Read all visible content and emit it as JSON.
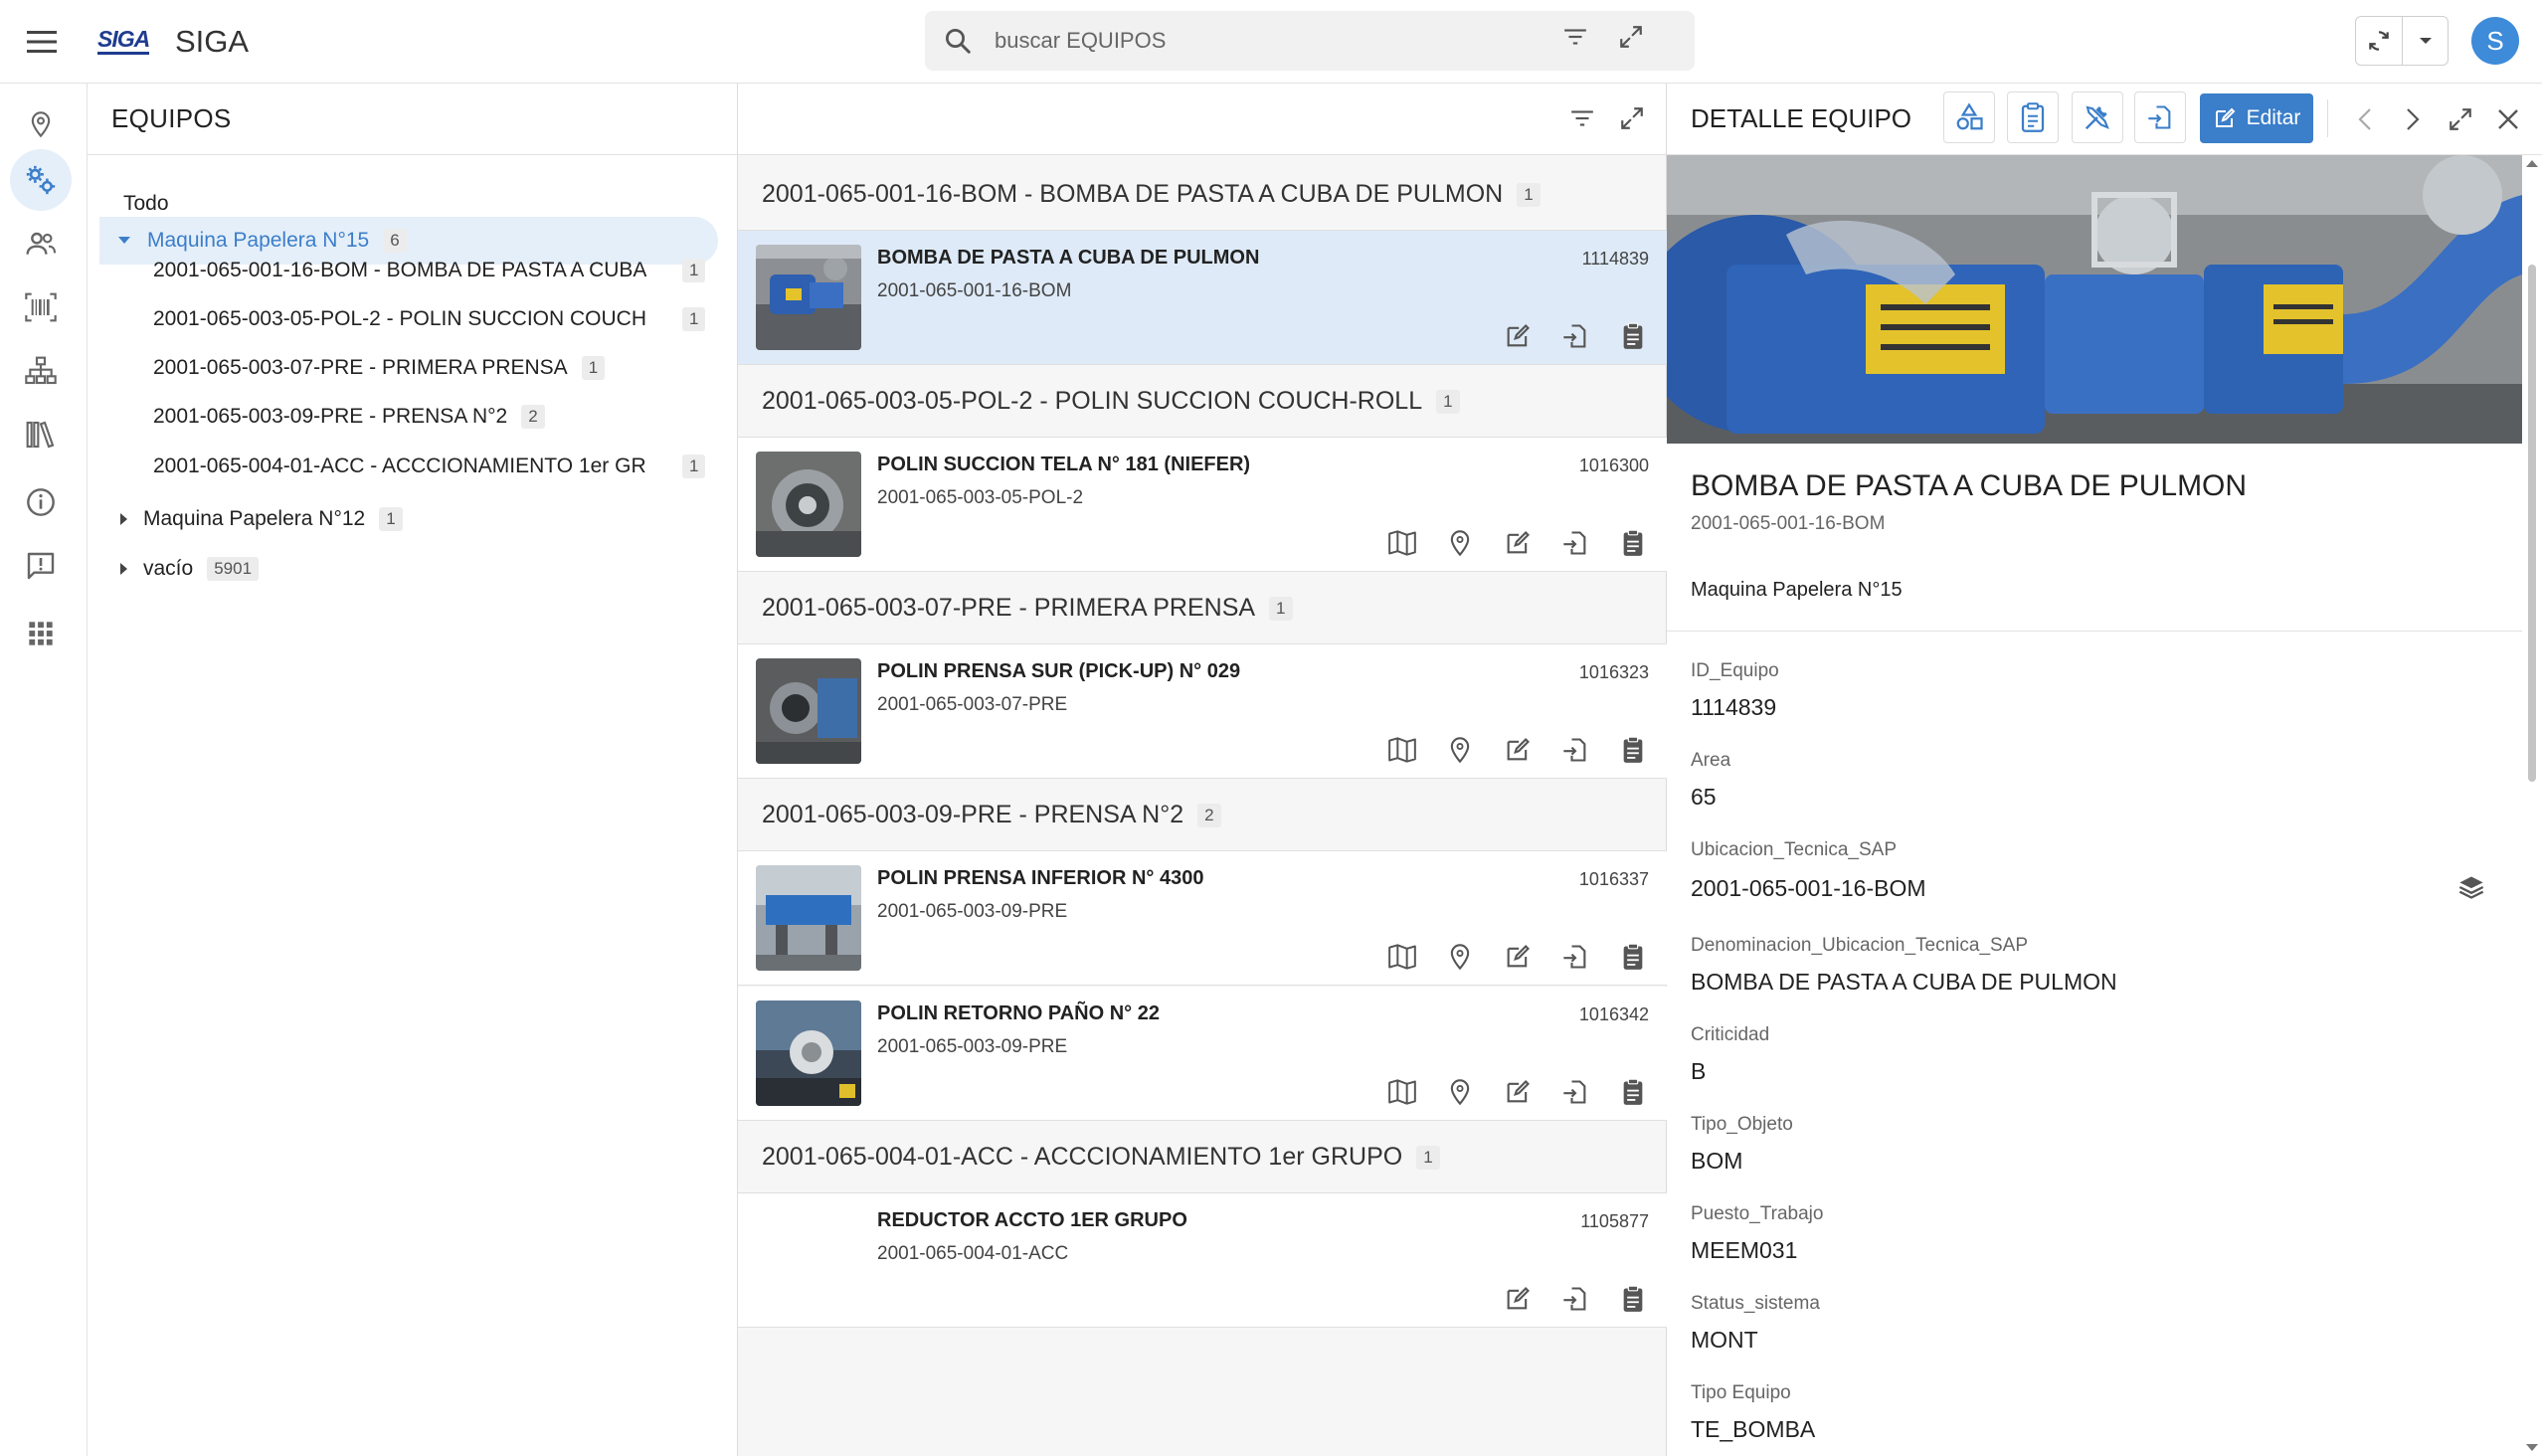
{
  "app": {
    "logo": "SIGA",
    "title": "SIGA",
    "avatar_initial": "S"
  },
  "search": {
    "placeholder": "buscar EQUIPOS",
    "value": ""
  },
  "tree": {
    "header": "EQUIPOS",
    "root": "Todo",
    "nodes": [
      {
        "label": "Maquina Papelera N°15",
        "count": "6",
        "expanded": true
      },
      {
        "label": "2001-065-001-16-BOM - BOMBA DE PASTA A CUBA ...",
        "count": "1"
      },
      {
        "label": "2001-065-003-05-POL-2 - POLIN SUCCION COUCH-...",
        "count": "1"
      },
      {
        "label": "2001-065-003-07-PRE - PRIMERA PRENSA",
        "count": "1"
      },
      {
        "label": "2001-065-003-09-PRE - PRENSA N°2",
        "count": "2"
      },
      {
        "label": "2001-065-004-01-ACC - ACCCIONAMIENTO 1er GR...",
        "count": "1"
      },
      {
        "label": "Maquina Papelera N°12",
        "count": "1"
      },
      {
        "label": "vacío",
        "count": "5901"
      }
    ]
  },
  "list": {
    "groups": [
      {
        "title": "2001-065-001-16-BOM - BOMBA DE PASTA A CUBA DE PULMON",
        "count": "1"
      },
      {
        "title": "2001-065-003-05-POL-2 - POLIN SUCCION COUCH-ROLL",
        "count": "1"
      },
      {
        "title": "2001-065-003-07-PRE - PRIMERA PRENSA",
        "count": "1"
      },
      {
        "title": "2001-065-003-09-PRE - PRENSA N°2",
        "count": "2"
      },
      {
        "title": "2001-065-004-01-ACC - ACCCIONAMIENTO 1er GRUPO",
        "count": "1"
      }
    ],
    "cards": [
      {
        "title": "BOMBA DE PASTA A CUBA DE PULMON",
        "code": "2001-065-001-16-BOM",
        "id": "1114839"
      },
      {
        "title": "POLIN SUCCION TELA N° 181 (NIEFER)",
        "code": "2001-065-003-05-POL-2",
        "id": "1016300"
      },
      {
        "title": "POLIN PRENSA SUR (PICK-UP) N° 029",
        "code": "2001-065-003-07-PRE",
        "id": "1016323"
      },
      {
        "title": "POLIN PRENSA INFERIOR N° 4300",
        "code": "2001-065-003-09-PRE",
        "id": "1016337"
      },
      {
        "title": "POLIN RETORNO PAÑO N° 22",
        "code": "2001-065-003-09-PRE",
        "id": "1016342"
      },
      {
        "title": "REDUCTOR ACCTO 1ER GRUPO",
        "code": "2001-065-004-01-ACC",
        "id": "1105877"
      }
    ]
  },
  "detail": {
    "header": "DETALLE EQUIPO",
    "edit_label": "Editar",
    "name": "BOMBA DE PASTA A CUBA DE PULMON",
    "code": "2001-065-001-16-BOM",
    "location": "Maquina Papelera N°15",
    "fields": [
      {
        "label": "ID_Equipo",
        "value": "1114839"
      },
      {
        "label": "Area",
        "value": "65"
      },
      {
        "label": "Ubicacion_Tecnica_SAP",
        "value": "2001-065-001-16-BOM"
      },
      {
        "label": "Denominacion_Ubicacion_Tecnica_SAP",
        "value": "BOMBA DE PASTA A CUBA DE PULMON"
      },
      {
        "label": "Criticidad",
        "value": "B"
      },
      {
        "label": "Tipo_Objeto",
        "value": "BOM"
      },
      {
        "label": "Puesto_Trabajo",
        "value": "MEEM031"
      },
      {
        "label": "Status_sistema",
        "value": "MONT"
      },
      {
        "label": "Tipo Equipo",
        "value": "TE_BOMBA"
      }
    ]
  },
  "colors": {
    "accent": "#3b7ec9",
    "selected_bg": "#deeaf7",
    "logo": "#1f3c8f",
    "avatar": "#3d8bd9"
  },
  "icons": {
    "rail": [
      "map-pin-icon",
      "equipment-gears-icon",
      "users-icon",
      "barcode-icon",
      "hierarchy-icon",
      "library-icon",
      "info-icon",
      "feedback-icon",
      "apps-grid-icon"
    ],
    "card_actions": [
      "map-icon",
      "location-pin-icon",
      "edit-icon",
      "export-icon",
      "clipboard-icon"
    ]
  }
}
